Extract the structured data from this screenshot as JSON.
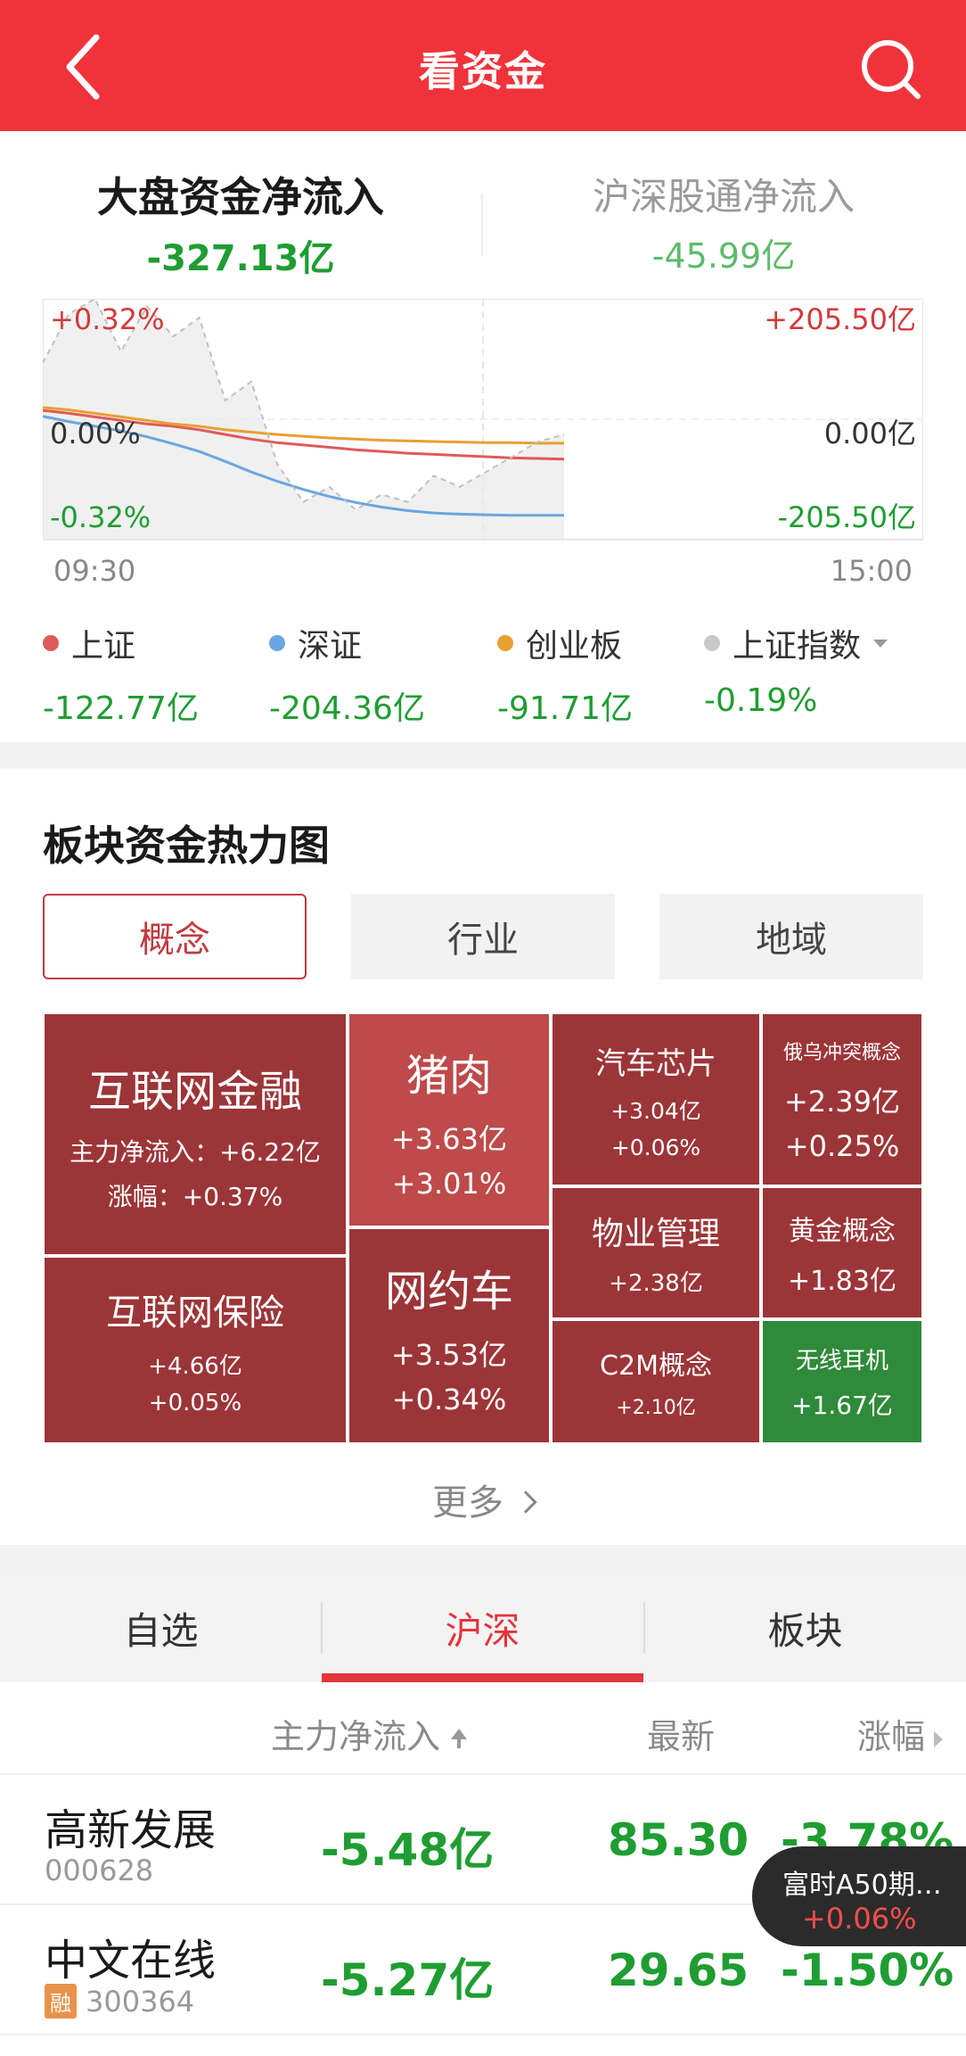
{
  "header": {
    "title": "看资金"
  },
  "flow_tabs": [
    {
      "label": "大盘资金净流入",
      "value": "-327.13亿"
    },
    {
      "label": "沪深股通净流入",
      "value": "-45.99亿"
    }
  ],
  "chart_data": {
    "type": "line",
    "y_left_ticks": [
      "+0.32%",
      "0.00%",
      "-0.32%"
    ],
    "y_right_ticks": [
      "+205.50亿",
      "0.00亿",
      "-205.50亿"
    ],
    "x_ticks": [
      "09:30",
      "15:00"
    ],
    "ylim_money": [
      -205.5,
      205.5
    ],
    "ylim_pct": [
      -0.32,
      0.32
    ],
    "series": [
      {
        "name": "上证",
        "color": "#e05a5a",
        "values": [
          15,
          10,
          4,
          -2,
          -8,
          -12,
          -18,
          -26,
          -34,
          -40,
          -44,
          -48,
          -52,
          -55,
          -58,
          -60,
          -62,
          -64,
          -66,
          -67,
          -68
        ]
      },
      {
        "name": "深证",
        "color": "#6aa6e0",
        "values": [
          5,
          -4,
          -12,
          -20,
          -30,
          -42,
          -55,
          -72,
          -90,
          -106,
          -120,
          -132,
          -142,
          -150,
          -156,
          -160,
          -162,
          -163,
          -164,
          -164,
          -164
        ]
      },
      {
        "name": "创业板",
        "color": "#e8a030",
        "values": [
          20,
          16,
          10,
          4,
          -2,
          -8,
          -12,
          -18,
          -22,
          -26,
          -29,
          -32,
          -34,
          -36,
          -37,
          -38,
          -39,
          -40,
          -40,
          -41,
          -41
        ]
      },
      {
        "name": "上证指数",
        "color": "#c0c0c0",
        "values": [
          0.15,
          0.28,
          0.32,
          0.18,
          0.3,
          0.22,
          0.27,
          0.05,
          0.1,
          -0.12,
          -0.22,
          -0.18,
          -0.24,
          -0.2,
          -0.22,
          -0.15,
          -0.18,
          -0.14,
          -0.1,
          -0.06,
          -0.04
        ]
      }
    ]
  },
  "legend": [
    {
      "name": "上证",
      "value": "-122.77亿",
      "color": "#e05a5a"
    },
    {
      "name": "深证",
      "value": "-204.36亿",
      "color": "#6aa6e0"
    },
    {
      "name": "创业板",
      "value": "-91.71亿",
      "color": "#e8a030"
    },
    {
      "name": "上证指数",
      "value": "-0.19%",
      "color": "#c8c8c8"
    }
  ],
  "heat": {
    "heading": "板块资金热力图",
    "segments": [
      "概念",
      "行业",
      "地域"
    ],
    "cells": [
      {
        "name": "互联网金融",
        "line1": "主力净流入：+6.22亿",
        "line2": "涨幅：+0.37%"
      },
      {
        "name": "互联网保险",
        "line1": "+4.66亿",
        "line2": "+0.05%"
      },
      {
        "name": "猪肉",
        "line1": "+3.63亿",
        "line2": "+3.01%"
      },
      {
        "name": "网约车",
        "line1": "+3.53亿",
        "line2": "+0.34%"
      },
      {
        "name": "汽车芯片",
        "line1": "+3.04亿",
        "line2": "+0.06%"
      },
      {
        "name": "物业管理",
        "line1": "+2.38亿"
      },
      {
        "name": "C2M概念",
        "line1": "+2.10亿"
      },
      {
        "name": "俄乌冲突概念",
        "line1": "+2.39亿",
        "line2": "+0.25%"
      },
      {
        "name": "黄金概念",
        "line1": "+1.83亿"
      },
      {
        "name": "无线耳机",
        "line1": "+1.67亿"
      }
    ],
    "more": "更多"
  },
  "bottom_tabs": [
    "自选",
    "沪深",
    "板块"
  ],
  "table": {
    "headers": {
      "flow": "主力净流入",
      "latest": "最新",
      "change": "涨幅"
    },
    "rows": [
      {
        "name": "高新发展",
        "code": "000628",
        "flow": "-5.48亿",
        "latest": "85.30",
        "change": "-3.78%"
      },
      {
        "name": "中文在线",
        "badge": "融",
        "code": "300364",
        "flow": "-5.27亿",
        "latest": "29.65",
        "change": "-1.50%"
      }
    ]
  },
  "floating": {
    "title": "富时A50期…",
    "value": "+0.06%"
  }
}
